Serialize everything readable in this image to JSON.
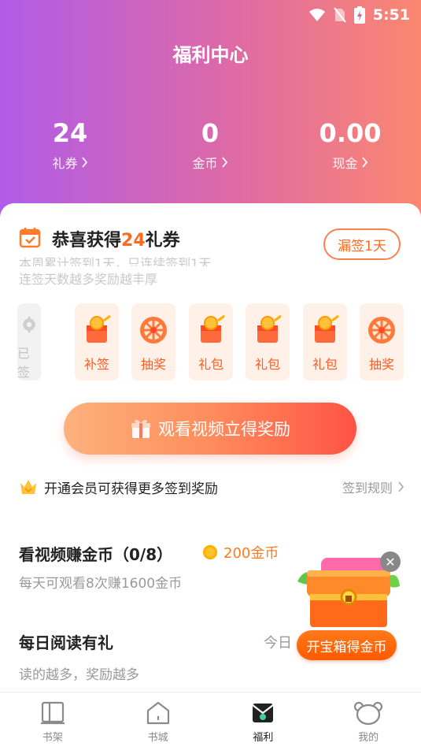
{
  "status_bar": {
    "time": "5:51"
  },
  "header": {
    "title": "福利中心"
  },
  "stats": [
    {
      "value": "24",
      "label": "礼券"
    },
    {
      "value": "0",
      "label": "金币"
    },
    {
      "value": "0.00",
      "label": "现金"
    }
  ],
  "signin": {
    "title_prefix": "恭喜获得",
    "title_highlight": "24",
    "title_suffix": "礼券",
    "miss_button": "漏签1天",
    "subtitle_line1": "本周累计签到1天，只连续签到1天",
    "subtitle_line2": "连签天数越多奖励越丰厚",
    "days": [
      {
        "label": "已签",
        "icon": "gear-icon"
      },
      {
        "label": "补签",
        "icon": "gift-coins-icon"
      },
      {
        "label": "抽奖",
        "icon": "lottery-wheel-icon"
      },
      {
        "label": "礼包",
        "icon": "gift-coins-icon"
      },
      {
        "label": "礼包",
        "icon": "gift-coins-icon"
      },
      {
        "label": "礼包",
        "icon": "gift-coins-icon"
      },
      {
        "label": "抽奖",
        "icon": "lottery-wheel-icon"
      }
    ],
    "watch_button": "观看视频立得奖励"
  },
  "vip": {
    "text": "开通会员可获得更多签到奖励",
    "rules_link": "签到规则"
  },
  "tasks": [
    {
      "title": "看视频赚金币（0/8）",
      "reward": "200金币",
      "desc": "每天可观看8次赚1600金币"
    },
    {
      "title": "每日阅读有礼",
      "reward": "今日",
      "desc": "读的越多，奖励越多"
    }
  ],
  "chest": {
    "button": "开宝箱得金币"
  },
  "tabbar": [
    {
      "label": "书架",
      "icon": "bookshelf-icon"
    },
    {
      "label": "书城",
      "icon": "bookstore-icon"
    },
    {
      "label": "福利",
      "icon": "welfare-envelope-icon"
    },
    {
      "label": "我的",
      "icon": "bear-profile-icon"
    }
  ],
  "colors": {
    "header_gradient": [
      "#b05ce8",
      "#de6aa6",
      "#fb8770"
    ],
    "accent": "#ff6a1f",
    "chest_button": "#ff5a00"
  }
}
